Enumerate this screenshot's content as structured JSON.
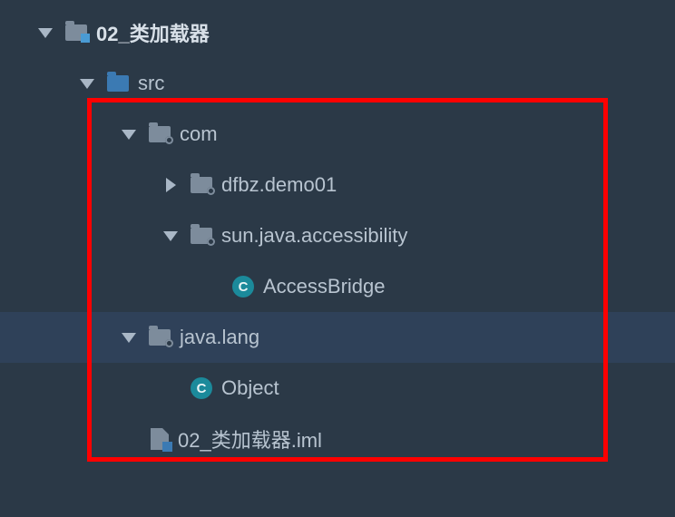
{
  "tree": {
    "module": {
      "label": "02_类加载器"
    },
    "src": {
      "label": "src"
    },
    "com": {
      "label": "com"
    },
    "dfbz": {
      "label": "dfbz.demo01"
    },
    "sun": {
      "label": "sun.java.accessibility"
    },
    "accessBridge": {
      "label": "AccessBridge",
      "badge": "C"
    },
    "javalang": {
      "label": "java.lang"
    },
    "object": {
      "label": "Object",
      "badge": "C"
    },
    "iml": {
      "label": "02_类加载器.iml"
    }
  }
}
